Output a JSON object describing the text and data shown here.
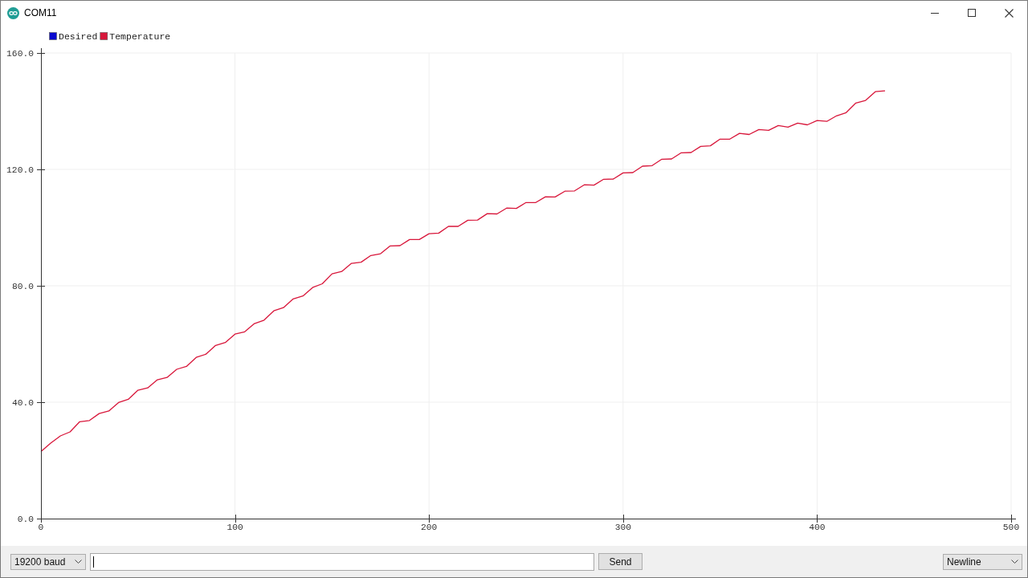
{
  "window": {
    "title": "COM11"
  },
  "plot": {
    "chart_data": {
      "type": "line",
      "x": [
        0,
        5,
        10,
        15,
        20,
        25,
        30,
        35,
        40,
        45,
        50,
        55,
        60,
        65,
        70,
        75,
        80,
        85,
        90,
        95,
        100,
        105,
        110,
        115,
        120,
        125,
        130,
        135,
        140,
        145,
        150,
        155,
        160,
        165,
        170,
        175,
        180,
        185,
        190,
        195,
        200,
        205,
        210,
        215,
        220,
        225,
        230,
        235,
        240,
        245,
        250,
        255,
        260,
        265,
        270,
        275,
        280,
        285,
        290,
        295,
        300,
        305,
        310,
        315,
        320,
        325,
        330,
        335,
        340,
        345,
        350,
        355,
        360,
        365,
        370,
        375,
        380,
        385,
        390,
        395,
        400,
        405,
        410,
        415,
        420,
        425,
        430,
        435
      ],
      "series": [
        {
          "name": "Desired",
          "color": "#0a0ad0",
          "values": [
            null,
            null,
            null,
            null,
            null,
            null,
            null,
            null,
            null,
            null,
            null,
            null,
            null,
            null,
            null,
            null,
            null,
            null,
            null,
            null,
            null,
            null,
            null,
            null,
            null,
            null,
            null,
            null,
            null,
            null,
            null,
            null,
            null,
            null,
            null,
            null,
            null,
            null,
            null,
            null,
            null,
            null,
            null,
            null,
            null,
            null,
            null,
            null,
            null,
            null,
            null,
            null,
            null,
            null,
            null,
            null,
            null,
            null,
            null,
            null,
            null,
            null,
            null,
            null,
            null,
            null,
            null,
            null,
            null,
            null,
            null,
            null,
            null,
            null,
            null,
            null,
            null,
            null,
            null,
            null,
            null,
            null,
            null,
            null,
            null,
            null,
            null,
            null
          ]
        },
        {
          "name": "Temperature",
          "color": "#d8163a",
          "values": [
            23.0,
            25.9,
            28.4,
            29.8,
            33.3,
            33.7,
            36.1,
            37.0,
            39.9,
            41.0,
            44.1,
            44.9,
            47.7,
            48.5,
            51.3,
            52.3,
            55.4,
            56.5,
            59.5,
            60.5,
            63.4,
            64.2,
            67.0,
            68.2,
            71.4,
            72.5,
            75.5,
            76.5,
            79.4,
            80.7,
            84.1,
            84.9,
            87.7,
            88.1,
            90.4,
            91.0,
            93.7,
            93.8,
            95.9,
            95.9,
            97.9,
            98.1,
            100.4,
            100.4,
            102.5,
            102.6,
            104.8,
            104.7,
            106.7,
            106.6,
            108.6,
            108.6,
            110.6,
            110.5,
            112.5,
            112.6,
            114.7,
            114.6,
            116.6,
            116.7,
            118.8,
            118.9,
            121.1,
            121.3,
            123.5,
            123.6,
            125.7,
            125.8,
            127.9,
            128.1,
            130.4,
            130.4,
            132.4,
            132.0,
            133.7,
            133.4,
            135.1,
            134.5,
            135.9,
            135.3,
            136.8,
            136.5,
            138.4,
            139.5,
            142.8,
            143.7,
            146.7,
            147.0
          ]
        }
      ],
      "xlim": [
        0,
        500
      ],
      "ylim": [
        0,
        160
      ],
      "xticks": [
        0,
        100,
        200,
        300,
        400,
        500
      ],
      "yticks": [
        {
          "value": 0,
          "label": "0.0"
        },
        {
          "value": 40,
          "label": "40.0"
        },
        {
          "value": 80,
          "label": "80.0"
        },
        {
          "value": 120,
          "label": "120.0"
        },
        {
          "value": 160,
          "label": "160.0"
        }
      ],
      "grid": true,
      "legend": "upper left"
    }
  },
  "bottom_bar": {
    "baud_rate": {
      "value": "19200 baud"
    },
    "message_input": {
      "focused": true
    },
    "send_button": {
      "label": "Send"
    },
    "line_ending": {
      "value": "Newline"
    }
  }
}
